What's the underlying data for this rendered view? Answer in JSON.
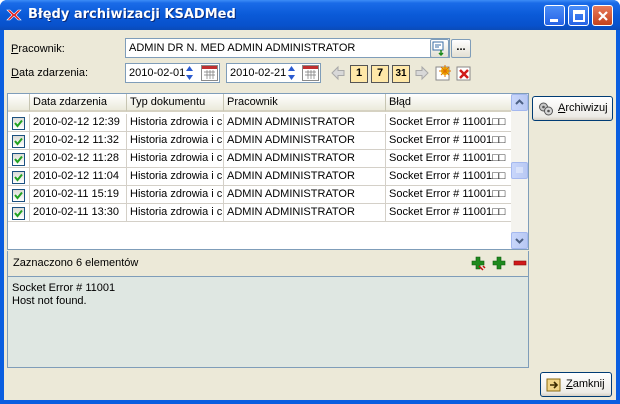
{
  "window": {
    "title": "Błędy archiwizacji KSADMed"
  },
  "filters": {
    "employee_label": "Pracownik:",
    "employee_value": "ADMIN DR N. MED ADMIN ADMINISTRATOR",
    "employee_lookup_label": "...",
    "date_label": "Data zdarzenia:",
    "date_from": "2010-02-01",
    "date_to": "2010-02-21",
    "day_label": "1",
    "week_label": "7",
    "month_label": "31"
  },
  "grid": {
    "columns": [
      "Data zdarzenia",
      "Typ dokumentu",
      "Pracownik",
      "Błąd"
    ],
    "rows": [
      {
        "checked": true,
        "date": "2010-02-12 12:39",
        "type": "Historia zdrowia i ch",
        "employee": "ADMIN ADMINISTRATOR",
        "error": "Socket Error # 11001□□"
      },
      {
        "checked": true,
        "date": "2010-02-12 11:32",
        "type": "Historia zdrowia i ch",
        "employee": "ADMIN ADMINISTRATOR",
        "error": "Socket Error # 11001□□"
      },
      {
        "checked": true,
        "date": "2010-02-12 11:28",
        "type": "Historia zdrowia i ch",
        "employee": "ADMIN ADMINISTRATOR",
        "error": "Socket Error # 11001□□"
      },
      {
        "checked": true,
        "date": "2010-02-12 11:04",
        "type": "Historia zdrowia i ch",
        "employee": "ADMIN ADMINISTRATOR",
        "error": "Socket Error # 11001□□"
      },
      {
        "checked": true,
        "date": "2010-02-11 15:19",
        "type": "Historia zdrowia i ch",
        "employee": "ADMIN ADMINISTRATOR",
        "error": "Socket Error # 11001□□"
      },
      {
        "checked": true,
        "date": "2010-02-11 13:30",
        "type": "Historia zdrowia i ch",
        "employee": "ADMIN ADMINISTRATOR",
        "error": "Socket Error # 11001□□"
      }
    ]
  },
  "status": {
    "selected_text": "Zaznaczono 6 elementów"
  },
  "message": {
    "line1": "Socket Error # 11001",
    "line2": "Host not found."
  },
  "buttons": {
    "archive": "Archiwizuj",
    "close": "Zamknij"
  },
  "colors": {
    "title_bar": "#0a5ad8",
    "client_bg": "#ece9d8",
    "message_bg": "#dfe7e2"
  }
}
